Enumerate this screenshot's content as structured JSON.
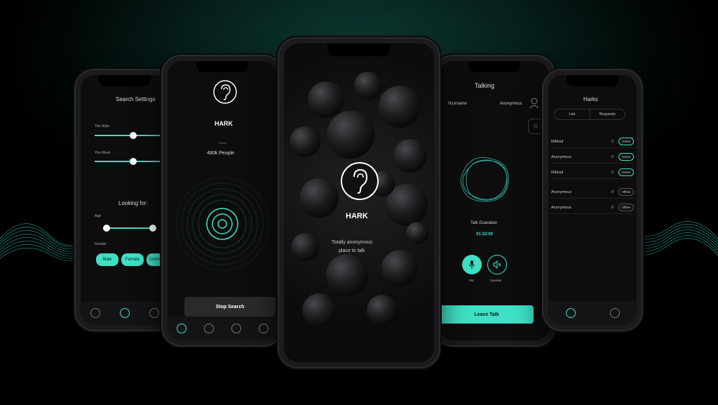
{
  "colors": {
    "accent": "#3fe0c5",
    "background": "#050a09"
  },
  "phone_search": {
    "title": "Search Settings",
    "style_label": "You Style",
    "mood_label": "You Mood",
    "looking_for": "Looking for:",
    "age_label": "Age",
    "gender_label": "Gender",
    "gender_options": [
      "Male",
      "Female",
      "Common"
    ]
  },
  "phone_hark": {
    "app_name": "HARK",
    "status": "Online",
    "people": "480k People",
    "stop_button": "Stop Search"
  },
  "phone_splash": {
    "app_name": "HARK",
    "tagline_line1": "Totally anonymous",
    "tagline_line2": "place to talk"
  },
  "phone_talk": {
    "title": "Talking",
    "nickname_label": "Nickname",
    "anonymous_label": "Anonymous",
    "duration_label": "Talk Duaration",
    "duration": "01:32:00",
    "mic_label": "Mic",
    "speaker_label": "Speaker",
    "leave_button": "Leave Talk"
  },
  "phone_harks": {
    "title": "Harks",
    "tab_list": "List",
    "tab_requests": "Requests",
    "rows": [
      {
        "name": "Mikhail",
        "status": "Online"
      },
      {
        "name": "Anonymous",
        "status": "Online"
      },
      {
        "name": "Mikhail",
        "status": "Online"
      },
      {
        "name": "Anonymous",
        "status": "Offline"
      },
      {
        "name": "Anonymous",
        "status": "Offline"
      }
    ]
  },
  "icons": [
    "ear-icon",
    "home-icon",
    "fingerprint-icon",
    "star-icon",
    "user-icon",
    "mic-icon",
    "speaker-icon"
  ]
}
